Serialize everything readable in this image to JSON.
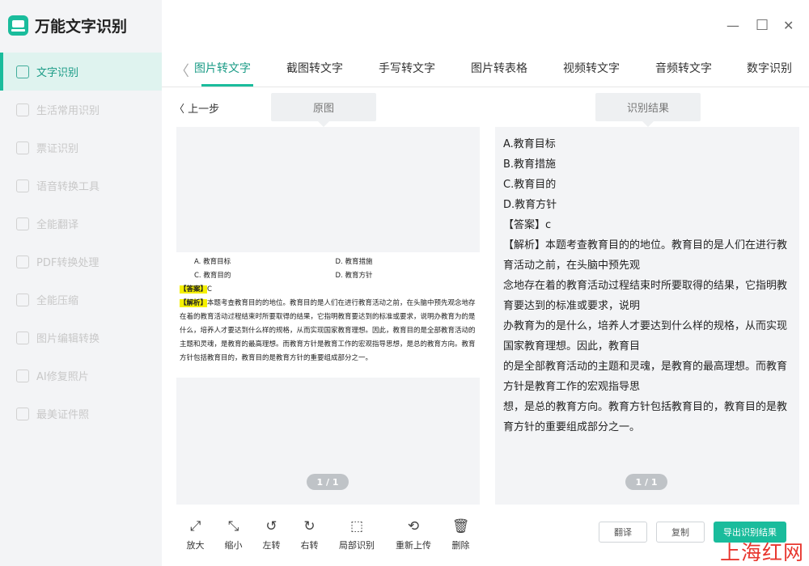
{
  "app": {
    "title": "万能文字识别"
  },
  "window": {
    "minimize": "—",
    "maximize": "□",
    "close": "✕"
  },
  "sidebar": {
    "items": [
      {
        "label": "文字识别",
        "active": true
      },
      {
        "label": "生活常用识别"
      },
      {
        "label": "票证识别"
      },
      {
        "label": "语音转换工具"
      },
      {
        "label": "全能翻译"
      },
      {
        "label": "PDF转换处理"
      },
      {
        "label": "全能压缩"
      },
      {
        "label": "图片编辑转换"
      },
      {
        "label": "AI修复照片"
      },
      {
        "label": "最美证件照"
      }
    ]
  },
  "tabs": {
    "back": "〈",
    "items": [
      "图片转文字",
      "截图转文字",
      "手写转文字",
      "图片转表格",
      "视频转文字",
      "音频转文字",
      "数字识别"
    ]
  },
  "left": {
    "back_label": "〈 上一步",
    "panel_label": "原图",
    "doc": {
      "opt_a": "A. 教育目标",
      "opt_d_right": "D. 教育措施",
      "opt_c": "C. 教育目的",
      "opt_d": "D. 教育方针",
      "answer_tag": "【答案】",
      "answer_val": "C",
      "analysis_tag": "【解析】",
      "analysis_text": "本题考查教育目的的地位。教育目的是人们在进行教育活动之前，在头脑中预先观念地存在着的教育活动过程结束时所要取得的结果，它指明教育要达到的标准或要求，说明办教育为的是什么，培养人才要达到什么样的规格，从而实现国家教育理想。因此，教育目的是全部教育活动的主题和灵魂，是教育的最高理想。而教育方针是教育工作的宏观指导思想，是总的教育方向。教育方针包括教育目的，教育目的是教育方针的重要组成部分之一。"
    },
    "page": "1 / 1"
  },
  "right": {
    "panel_label": "识别结果",
    "lines": [
      "A.教育目标",
      "B.教育措施",
      "C.教育目的",
      "D.教育方针",
      "【答案】c",
      "【解析】本题考查教育目的的地位。教育目的是人们在进行教育活动之前，在头脑中预先观",
      "念地存在着的教育活动过程结束时所要取得的结果，它指明教育要达到的标准或要求，说明",
      "办教育为的是什么，培养人才要达到什么样的规格，从而实现国家教育理想。因此，教育目",
      "的是全部教育活动的主题和灵魂，是教育的最高理想。而教育方针是教育工作的宏观指导思",
      "想，是总的教育方向。教育方针包括教育目的，教育目的是教育方针的重要组成部分之一。"
    ],
    "page": "1 / 1"
  },
  "toolbar": {
    "tools": [
      {
        "label": "放大",
        "icon": "expand-icon"
      },
      {
        "label": "缩小",
        "icon": "shrink-icon"
      },
      {
        "label": "左转",
        "icon": "rotate-left-icon"
      },
      {
        "label": "右转",
        "icon": "rotate-right-icon"
      },
      {
        "label": "局部识别",
        "icon": "crop-icon"
      },
      {
        "label": "重新上传",
        "icon": "reupload-icon"
      },
      {
        "label": "删除",
        "icon": "trash-icon"
      }
    ]
  },
  "actions": {
    "translate": "翻译",
    "copy": "复制",
    "export": "导出识别结果"
  },
  "watermark": "上海红网",
  "colors": {
    "accent": "#1abc9c",
    "highlight": "#f5f000"
  }
}
